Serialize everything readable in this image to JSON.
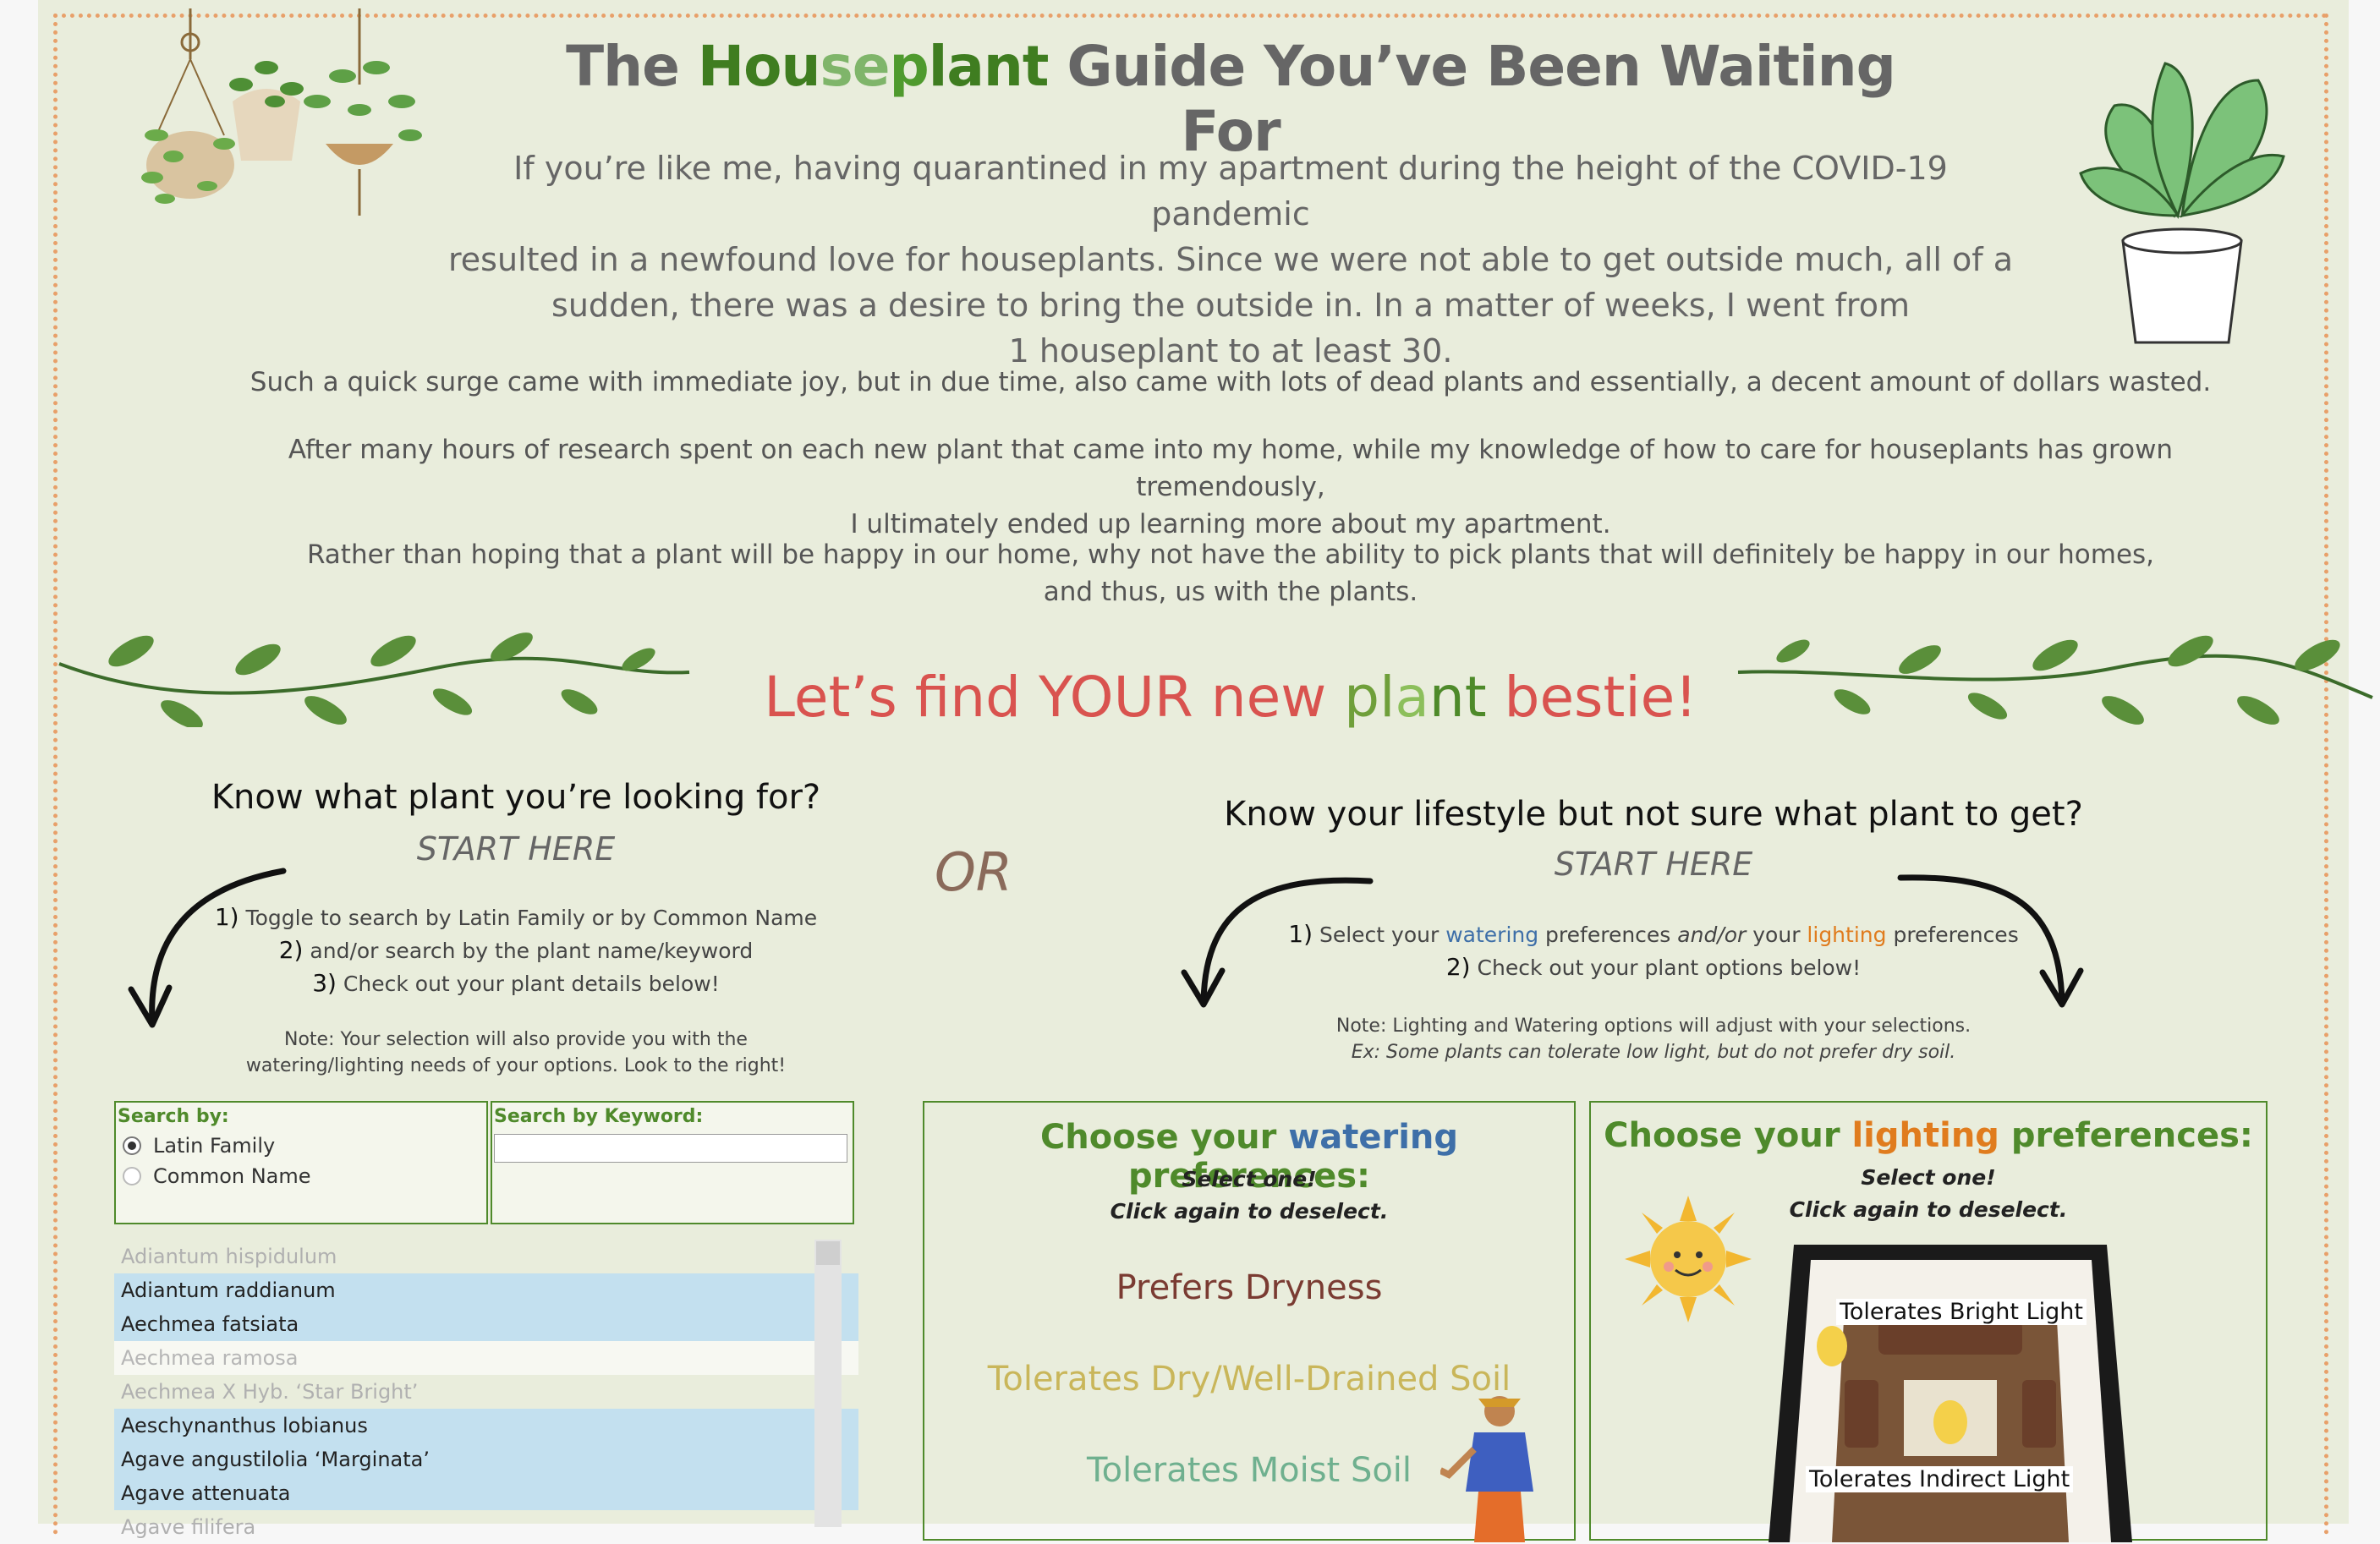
{
  "header": {
    "title_pre": "The ",
    "title_h1": "Hou",
    "title_h2": "se",
    "title_h3": "p",
    "title_h4": "lant",
    "title_post": " Guide You’ve Been Waiting For"
  },
  "intro": {
    "line1": "If you’re like me, having quarantined in my apartment during the height of the COVID-19 pandemic",
    "line2": "resulted in a newfound love for houseplants. Since we were not able to get outside much, all of a",
    "line3": "sudden, there was a desire to bring the outside in. In a matter of weeks, I went from",
    "line4": "1 houseplant to at least 30."
  },
  "paragraphs": {
    "p1": "Such a quick surge came with immediate joy, but in due time, also came with lots of dead plants and essentially, a decent amount of dollars wasted.",
    "p2a": "After many hours of research spent on each new plant that came into my home, while my knowledge of how to care for houseplants has grown tremendously,",
    "p2b": "I ultimately ended up learning more about my apartment.",
    "p3a": "Rather than hoping that a plant will be happy in our home, why not have the ability to pick plants that will definitely be happy in our homes,",
    "p3b": "and thus, us with the plants."
  },
  "bestie": {
    "a": "Let’s find YOUR new ",
    "b": "pl",
    "c": "a",
    "d": "nt",
    "e": " bestie!"
  },
  "left": {
    "heading": "Know what plant you’re looking for?",
    "start": "START HERE",
    "step1_num": "1)",
    "step1": " Toggle to search by Latin Family or by Common Name",
    "step2_num": "2)",
    "step2": " and/or search by the plant name/keyword",
    "step3_num": "3)",
    "step3": " Check out your plant details below!",
    "note1": "Note: Your selection will also provide you with the",
    "note2": "watering/lighting needs of your options. Look to the right!"
  },
  "or": "OR",
  "right": {
    "heading": "Know your lifestyle but not sure what plant to get?",
    "start": "START HERE",
    "step1_num": "1)",
    "step1a": " Select your ",
    "step1_water": "watering",
    "step1b": " preferences  ",
    "step1_andor": "and/or",
    "step1c": "  your ",
    "step1_light": "lighting",
    "step1d": " preferences",
    "step2_num": "2)",
    "step2": " Check out your plant options below!",
    "note1": "Note: Lighting and Watering options will adjust with your selections.",
    "note2": "Ex: Some plants can tolerate low light, but do not prefer dry soil."
  },
  "search": {
    "label": "Search by:",
    "option1": "Latin Family",
    "option2": "Common Name",
    "selected": "Latin Family",
    "keyword_label": "Search by Keyword:",
    "keyword_value": ""
  },
  "plant_list": [
    {
      "name": "Adiantum hispidulum",
      "state": "dim"
    },
    {
      "name": "Adiantum raddianum",
      "state": "selected"
    },
    {
      "name": "Aechmea fatsiata",
      "state": "selected"
    },
    {
      "name": "Aechmea ramosa",
      "state": "white"
    },
    {
      "name": "Aechmea X Hyb. ‘Star Bright’",
      "state": "dim"
    },
    {
      "name": "Aeschynanthus lobianus",
      "state": "selected"
    },
    {
      "name": "Agave angustilolia ‘Marginata’",
      "state": "selected"
    },
    {
      "name": "Agave attenuata",
      "state": "selected"
    },
    {
      "name": "Agave filifera",
      "state": "dim"
    }
  ],
  "watering": {
    "title_a": "Choose your ",
    "title_b": "watering",
    "title_c": " preferences:",
    "sub1": "Select one!",
    "sub2": "Click again to deselect.",
    "options": [
      "Prefers Dryness",
      "Tolerates Dry/Well-Drained Soil",
      "Tolerates Moist Soil"
    ],
    "option_colors": [
      "#7a3b32",
      "#c9b65a",
      "#6fb08f"
    ]
  },
  "lighting": {
    "title_a": "Choose your ",
    "title_b": "lighting",
    "title_c": " preferences:",
    "sub1": "Select one!",
    "sub2": "Click again to deselect.",
    "options": [
      "Tolerates Bright Light",
      "Tolerates Indirect Light"
    ]
  },
  "colors": {
    "accent_green": "#4f8a2b",
    "accent_red": "#d9534f",
    "border_dots": "#e8a06a",
    "selected_row": "#c3e0ef"
  }
}
